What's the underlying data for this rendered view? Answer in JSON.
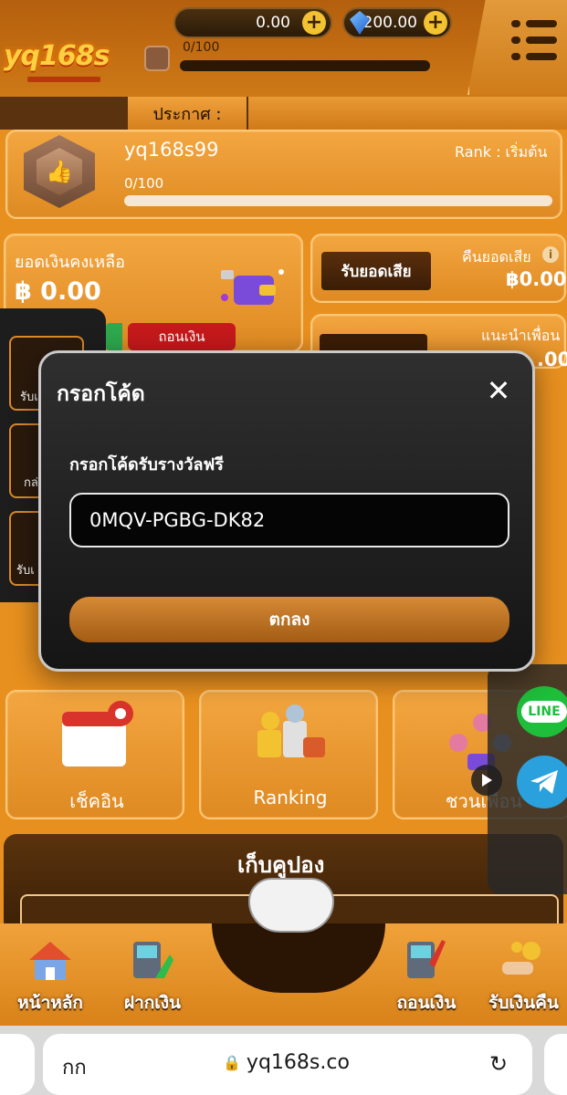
{
  "header": {
    "credit_value": "0.00",
    "gem_value": "200.00",
    "xp_progress": "0/100",
    "plus_symbol": "+",
    "logo_text": "yq168s"
  },
  "announce": {
    "label": "ประกาศ :"
  },
  "profile": {
    "username": "yq168s99",
    "rank": "Rank : เริ่มต้น",
    "progress": "0/100"
  },
  "balance": {
    "label": "ยอดเงินคงเหลือ",
    "value": "฿ 0.00",
    "withdraw_partial": "ถอนเงิน"
  },
  "cashback": {
    "button": "รับยอดเสีย",
    "label": "คืนยอดเสีย",
    "value": "฿0.00"
  },
  "invite_card": {
    "label": "แนะนำเพื่อน",
    "value_stub": ".00"
  },
  "side_panel": {
    "items": [
      {
        "label": "รับเ"
      },
      {
        "label": "กล่"
      },
      {
        "label": "รับเ"
      }
    ]
  },
  "shortcuts": [
    {
      "label": "เช็คอิน"
    },
    {
      "label": "Ranking"
    },
    {
      "label": "ชวนเพื่อน"
    }
  ],
  "coupon": {
    "title": "เก็บคูปอง"
  },
  "social": {
    "line_label": "LINE"
  },
  "bottom_nav": [
    {
      "label": "หน้าหลัก"
    },
    {
      "label": "ฝากเงิน"
    },
    {
      "label": "ถอนเงิน"
    },
    {
      "label": "รับเงินคืน"
    }
  ],
  "modal": {
    "title": "กรอกโค้ด",
    "close_symbol": "✕",
    "field_label": "กรอกโค้ดรับรางวัลฟรี",
    "code_value": "0MQV-PGBG-DK82",
    "confirm_label": "ตกลง"
  },
  "browser": {
    "text_size_label": "กก",
    "url": "yq168s.co",
    "reload_symbol": "↻",
    "lock_symbol": "🔒"
  }
}
